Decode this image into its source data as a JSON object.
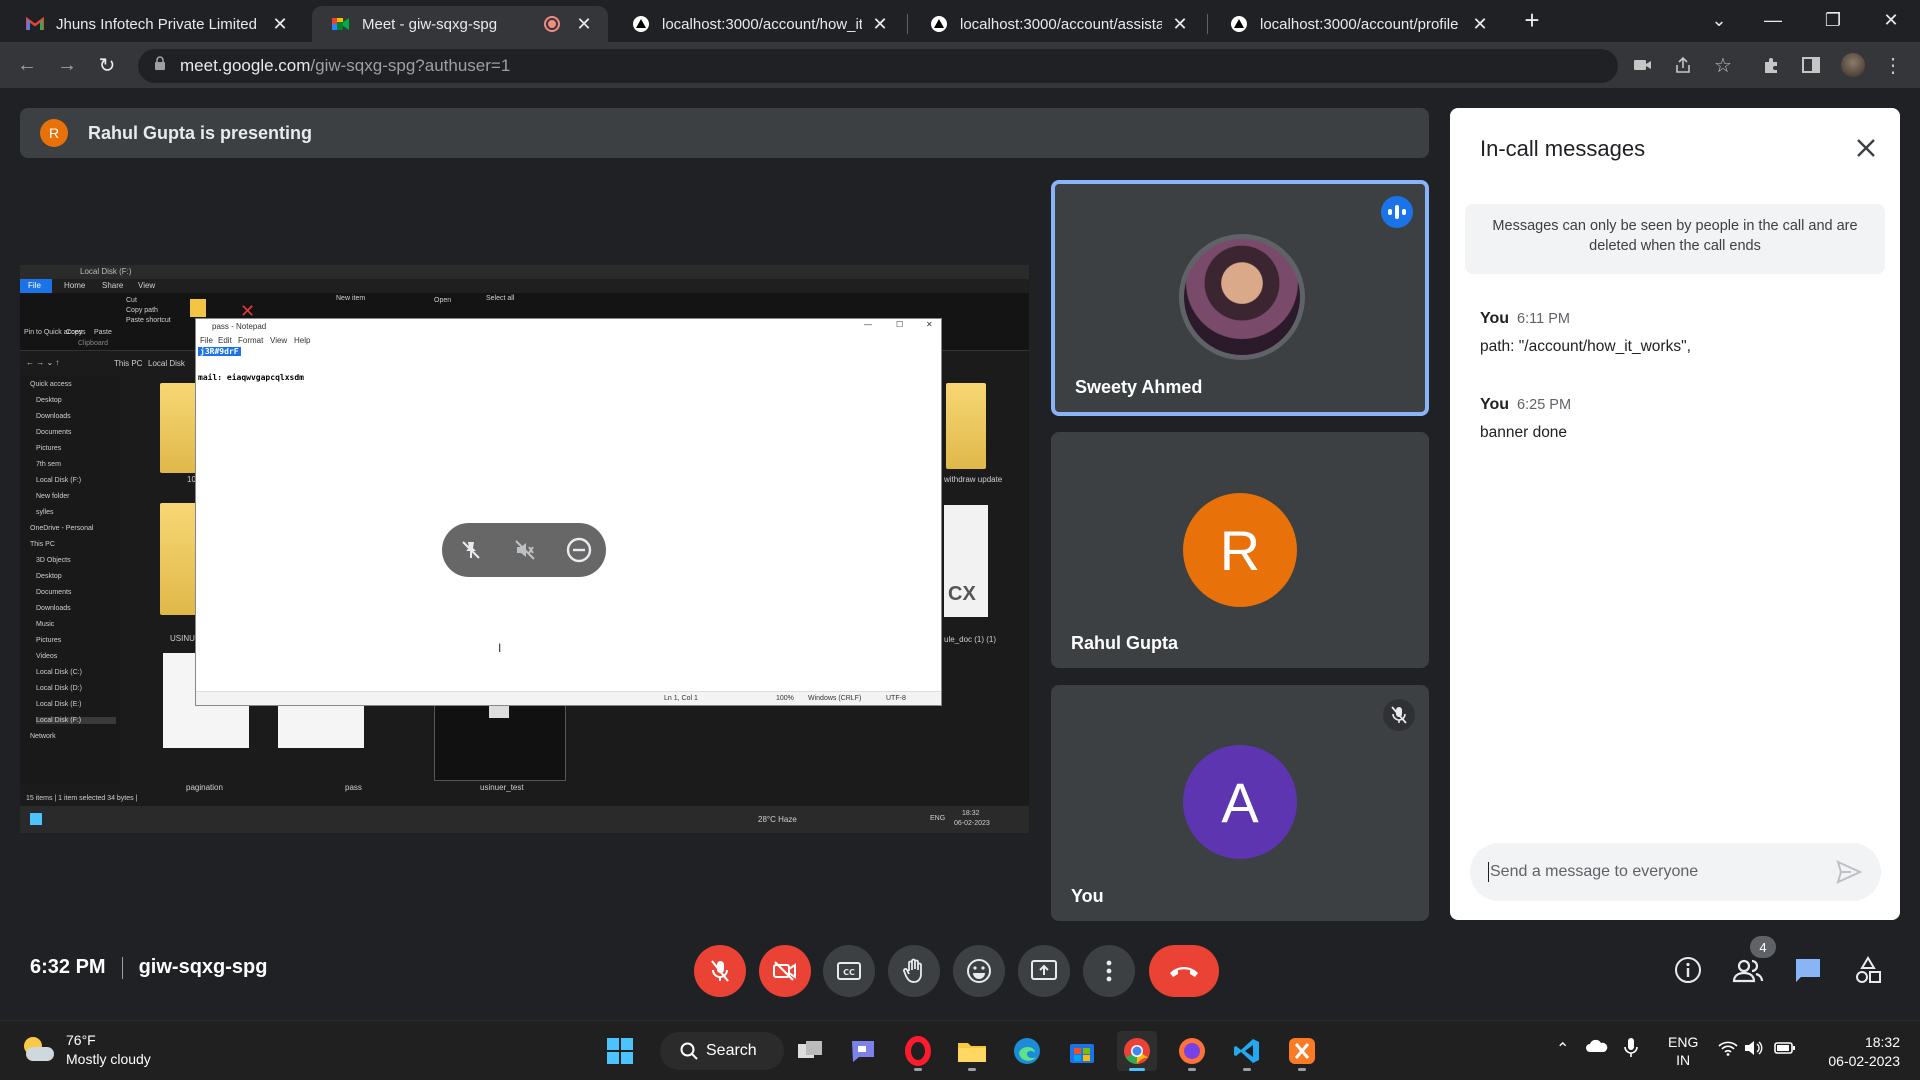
{
  "tabs": [
    {
      "title": "Jhuns Infotech Private Limited M",
      "favicon": "gmail-icon"
    },
    {
      "title": "Meet - giw-sqxg-spg",
      "favicon": "meet-icon",
      "active": true
    },
    {
      "title": "localhost:3000/account/how_it_w",
      "favicon": "triangle-icon"
    },
    {
      "title": "localhost:3000/account/assistanc",
      "favicon": "triangle-icon"
    },
    {
      "title": "localhost:3000/account/profile",
      "favicon": "triangle-icon"
    }
  ],
  "address": {
    "host": "meet.google.com",
    "path": "/giw-sqxg-spg?authuser=1"
  },
  "presenting": {
    "initial": "R",
    "text": "Rahul Gupta is presenting"
  },
  "screenshare": {
    "explorer": {
      "title": "Local Disk (F:)",
      "ribbon_tabs": [
        "File",
        "Home",
        "Share",
        "View"
      ],
      "ribbon_items": [
        "Pin to Quick access",
        "Copy",
        "Paste",
        "Cut",
        "Copy path",
        "Paste shortcut",
        "Clipboard",
        "New item",
        "Open",
        "Select all"
      ],
      "breadcrumb": [
        "This PC",
        "Local Disk"
      ],
      "nav": [
        "Quick access",
        "Desktop",
        "Downloads",
        "Documents",
        "Pictures",
        "7th sem",
        "Local Disk (F:)",
        "New folder",
        "sylles",
        "OneDrive - Personal",
        "This PC",
        "3D Objects",
        "Desktop",
        "Documents",
        "Downloads",
        "Music",
        "Pictures",
        "Videos",
        "Local Disk (C:)",
        "Local Disk (D:)",
        "Local Disk (E:)",
        "Local Disk (F:)",
        "Network"
      ],
      "files": [
        "pagination",
        "pass",
        "usinuer_test",
        "withdraw update",
        "ule_doc (1) (1)",
        "USINU",
        "10"
      ],
      "doc_badge": "CX",
      "status": "15 items  |  1 item selected  34 bytes  |",
      "taskbar_weather": "28°C  Haze",
      "taskbar_lang": "ENG",
      "taskbar_time": "18:32",
      "taskbar_date": "06-02-2023"
    },
    "notepad": {
      "title": "pass - Notepad",
      "menu": [
        "File",
        "Edit",
        "Format",
        "View",
        "Help"
      ],
      "line1": "j3R#9drF",
      "line2": "mail: eiaqwvgapcqlxsdm",
      "status": [
        "Ln 1, Col 1",
        "100%",
        "Windows (CRLF)",
        "UTF-8"
      ]
    }
  },
  "participants": [
    {
      "name": "Sweety Ahmed",
      "speaking": true
    },
    {
      "name": "Rahul Gupta",
      "initial": "R",
      "color": "#e8710a"
    },
    {
      "name": "You",
      "initial": "A",
      "color": "#5e35b1",
      "muted": true
    }
  ],
  "chat": {
    "title": "In-call messages",
    "notice": "Messages can only be seen by people in the call and are deleted when the call ends",
    "messages": [
      {
        "sender": "You",
        "time": "6:11 PM",
        "text": "path: \"/account/how_it_works\","
      },
      {
        "sender": "You",
        "time": "6:25 PM",
        "text": "banner done"
      }
    ],
    "input_placeholder": "Send a message to everyone"
  },
  "meeting": {
    "time": "6:32 PM",
    "code": "giw-sqxg-spg",
    "people_count": "4"
  },
  "taskbar": {
    "weather_temp": "76°F",
    "weather_desc": "Mostly cloudy",
    "search": "Search",
    "lang1": "ENG",
    "lang2": "IN",
    "time": "18:32",
    "date": "06-02-2023"
  },
  "colors": {
    "accent_blue": "#8ab4f8",
    "end_call_red": "#ea4335",
    "speaking_blue": "#1a73e8"
  }
}
